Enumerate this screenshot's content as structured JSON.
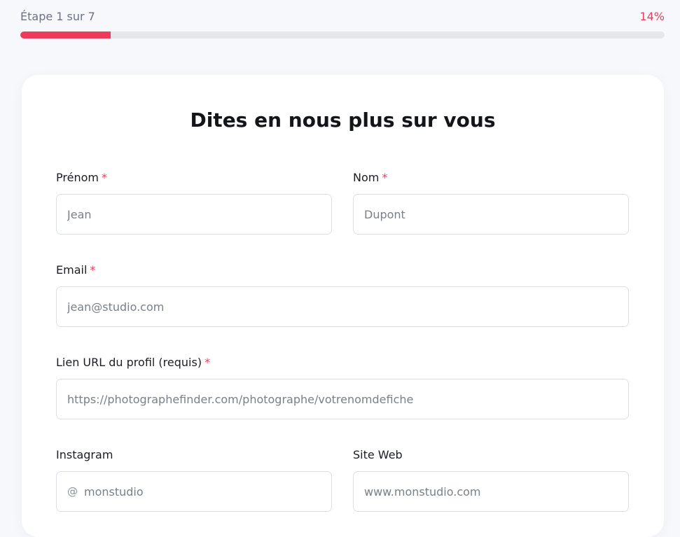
{
  "progress": {
    "step_label": "Étape 1 sur 7",
    "percent_label": "14%",
    "fraction": 0.14,
    "color": "#ef3b5b"
  },
  "form": {
    "title": "Dites en nous plus sur vous",
    "required_marker": "*",
    "fields": {
      "first_name": {
        "label": "Prénom",
        "placeholder": "Jean"
      },
      "last_name": {
        "label": "Nom",
        "placeholder": "Dupont"
      },
      "email": {
        "label": "Email",
        "placeholder": "jean@studio.com"
      },
      "profile_url": {
        "label": "Lien URL du profil (requis)",
        "placeholder": "https://photographefinder.com/photographe/votrenomdefiche"
      },
      "instagram": {
        "label": "Instagram",
        "prefix": "@",
        "placeholder": "monstudio"
      },
      "website": {
        "label": "Site Web",
        "placeholder": "www.monstudio.com"
      }
    }
  }
}
